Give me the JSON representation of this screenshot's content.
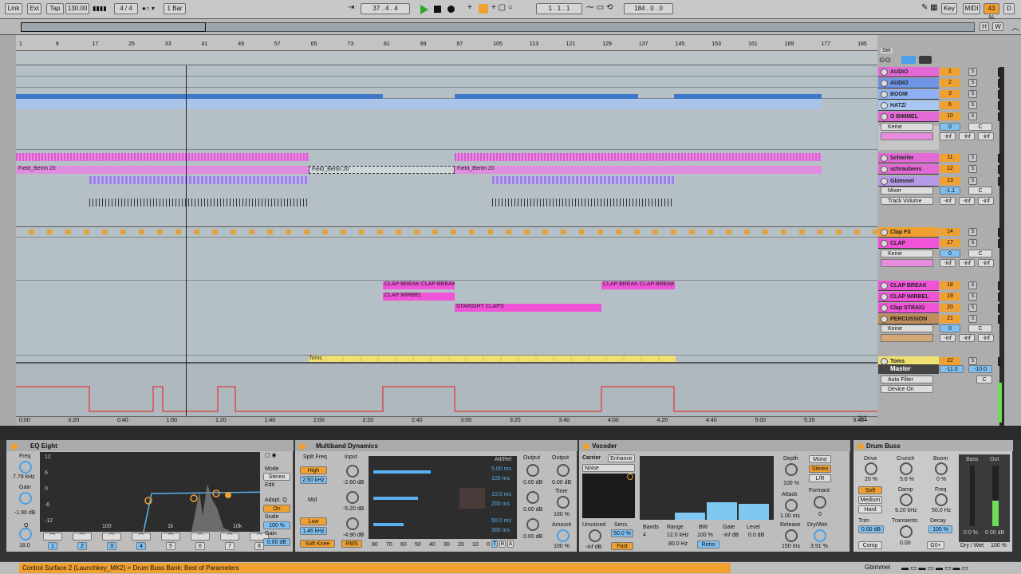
{
  "toolbar": {
    "link": "Link",
    "ext": "Ext",
    "tap": "Tap",
    "tempo": "130.00",
    "meter": "4 / 4",
    "quant": "1 Bar",
    "pos": "37 . 4 . 4",
    "loop_start": "1 . 1 . 1",
    "loop_len": "184 . 0 . 0",
    "key": "Key",
    "midi": "MIDI",
    "cpu": "43 %",
    "d": "D"
  },
  "overview": {
    "h": "H",
    "w": "W"
  },
  "ruler": [
    "1",
    "9",
    "17",
    "25",
    "33",
    "41",
    "49",
    "57",
    "65",
    "73",
    "81",
    "89",
    "97",
    "105",
    "113",
    "121",
    "129",
    "137",
    "145",
    "153",
    "161",
    "169",
    "177",
    "185"
  ],
  "time": [
    "0:00",
    "0:20",
    "0:40",
    "1:00",
    "1:20",
    "1:40",
    "2:00",
    "2:20",
    "2:40",
    "3:00",
    "3:20",
    "3:40",
    "4:00",
    "4:20",
    "4:40",
    "5:00",
    "5:20",
    "5:40"
  ],
  "clips": {
    "field1": "Field_Berlin 20",
    "field2": "Field_Berlin 20",
    "field3": "Field_Berlin 20",
    "cb1": "CLAP BREAK CLAP BREAK",
    "cb2": "CLAP BREAK CLAP BREAK",
    "cw": "CLAP WIRBEL",
    "cs": "STARIGHT CLAPS",
    "toms": "Toms",
    "set": "Set",
    "page": "2/1"
  },
  "tracks": [
    {
      "name": "AUDIO",
      "num": "1",
      "color": "#e36ad6"
    },
    {
      "name": "AUDIO",
      "num": "2",
      "color": "#6f95e6"
    },
    {
      "name": "BOOM",
      "num": "3",
      "color": "#8fb0f2"
    },
    {
      "name": "HATZ/",
      "num": "6",
      "color": "#a8c6f2"
    },
    {
      "name": "G BIMMEL",
      "num": "10",
      "color": "#e36ad6"
    },
    {
      "name": "Schleifer",
      "num": "11",
      "color": "#e36ad6"
    },
    {
      "name": "schraubens",
      "num": "12",
      "color": "#e36ad6"
    },
    {
      "name": "Gbimmel",
      "num": "13",
      "color": "#b59ae8"
    },
    {
      "name": "Clap FX",
      "num": "14",
      "color": "#f0a030"
    },
    {
      "name": "CLAP",
      "num": "17",
      "color": "#f052d8"
    },
    {
      "name": "CLAP BREAK",
      "num": "18",
      "color": "#f052d8"
    },
    {
      "name": "CLAP WIRBEL",
      "num": "19",
      "color": "#f052d8"
    },
    {
      "name": "Clap STRAIG",
      "num": "20",
      "color": "#f052d8"
    },
    {
      "name": "PERCUSSION",
      "num": "21",
      "color": "#c08e5a"
    },
    {
      "name": "Toms",
      "num": "22",
      "color": "#f0e070"
    }
  ],
  "mixer": {
    "keine1": "Keine",
    "keine2": "Keine",
    "keine3": "Keine",
    "zero": "0",
    "c": "C",
    "inf": "-inf",
    "mixer": "Mixer",
    "tv": "Track Volume",
    "v11": "-1.1",
    "master": "Master",
    "mv1": "-11.0",
    "mv2": "-10.0",
    "autofilter": "Auto Filter",
    "devon": "Device On"
  },
  "eq": {
    "title": "EQ Eight",
    "freq": "Freq",
    "freq_v": "7.79 kHz",
    "gain": "Gain",
    "gain_v": "-1.90 dB",
    "q": "Q",
    "q_v": "18.0",
    "mode": "Mode",
    "mode_v": "Stereo",
    "edit": "Edit",
    "adaptq": "Adapt. Q",
    "on": "On",
    "scale": "Scale",
    "scale_v": "100 %",
    "gain2": "Gain",
    "gain2_v": "0.00 dB",
    "y": [
      "12",
      "6",
      "0",
      "-6",
      "-12"
    ],
    "x": [
      "100",
      "1k",
      "10k"
    ],
    "bands": [
      "1",
      "2",
      "3",
      "4",
      "5",
      "6",
      "7",
      "8"
    ]
  },
  "mb": {
    "title": "Multiband Dynamics",
    "split": "Split Freq",
    "input": "Input",
    "high": "High",
    "high_v": "2.50 kHz",
    "mid": "Mid",
    "low": "Low",
    "low_v": "1.46 kHz",
    "in1": "-2.60 dB",
    "in2": "-5.20 dB",
    "in3": "-4.90 dB",
    "attrel": "Att/Rel",
    "ar": [
      "5.00 ms",
      "100 ms",
      "10.0 ms",
      "200 ms",
      "50.0 ms",
      "300 ms"
    ],
    "output": "Output",
    "out": [
      "0.00 dB",
      "0.00 dB",
      "0.00 dB"
    ],
    "output2": "Output",
    "out2": "0.00 dB",
    "time": "Time",
    "time_v": "100 %",
    "amount": "Amount",
    "amount_v": "100 %",
    "scale": [
      "80",
      "70",
      "60",
      "50",
      "40",
      "30",
      "20",
      "10",
      "0"
    ],
    "softknee": "Soft Knee",
    "rms": "RMS",
    "t": "T",
    "b": "B",
    "a": "A"
  },
  "voc": {
    "title": "Vocoder",
    "carrier": "Carrier",
    "enhance": "Enhance",
    "noise": "Noise",
    "unvoiced": "Unvoiced",
    "unv_v": "-inf dB",
    "sens": "Sens.",
    "sens_v": "50.0 %",
    "fast": "Fast",
    "bands": "Bands",
    "bands_v": "4",
    "range": "Range",
    "range_v": "12.0 kHz",
    "range_v2": "80.0 Hz",
    "bw": "BW",
    "bw_v": "100 %",
    "gate": "Gate",
    "gate_v": "-inf dB",
    "level": "Level",
    "level_v": "0.0 dB",
    "retro": "Retro",
    "depth": "Depth",
    "depth_v": "100 %",
    "attack": "Attack",
    "attack_v": "1.00 ms",
    "release": "Release",
    "release_v": "150 ms",
    "mono": "Mono",
    "stereo": "Stereo",
    "lr": "L/R",
    "formant": "Formant",
    "formant_v": "0",
    "drywet": "Dry/Wet",
    "drywet_v": "3.91 %"
  },
  "db": {
    "title": "Drum Buss",
    "drive": "Drive",
    "drive_v": "20 %",
    "crunch": "Crunch",
    "crunch_v": "5.6 %",
    "boom": "Boom",
    "boom_v": "0 %",
    "soft": "Soft",
    "medium": "Medium",
    "hard": "Hard",
    "damp": "Damp",
    "damp_v": "9.20 kHz",
    "freq": "Freq",
    "freq_v": "50.0 Hz",
    "trim": "Trim",
    "trim_v": "0.00 dB",
    "transients": "Transients",
    "trans_v": "0.00",
    "decay": "Decay",
    "decay_v": "100 %",
    "comp": "Comp",
    "bass": "Bass",
    "out": "Out",
    "bass_v": "0.0 %",
    "out_v": "0.00 dB",
    "g0": "G0+",
    "drywet": "Dry / Wet",
    "drywet_v": "100 %"
  },
  "status": {
    "text": "Control Surface 2 (Launchkey_MK2) > Drum Buss Bank: Best of Parameters",
    "track": "Gbimmel"
  }
}
